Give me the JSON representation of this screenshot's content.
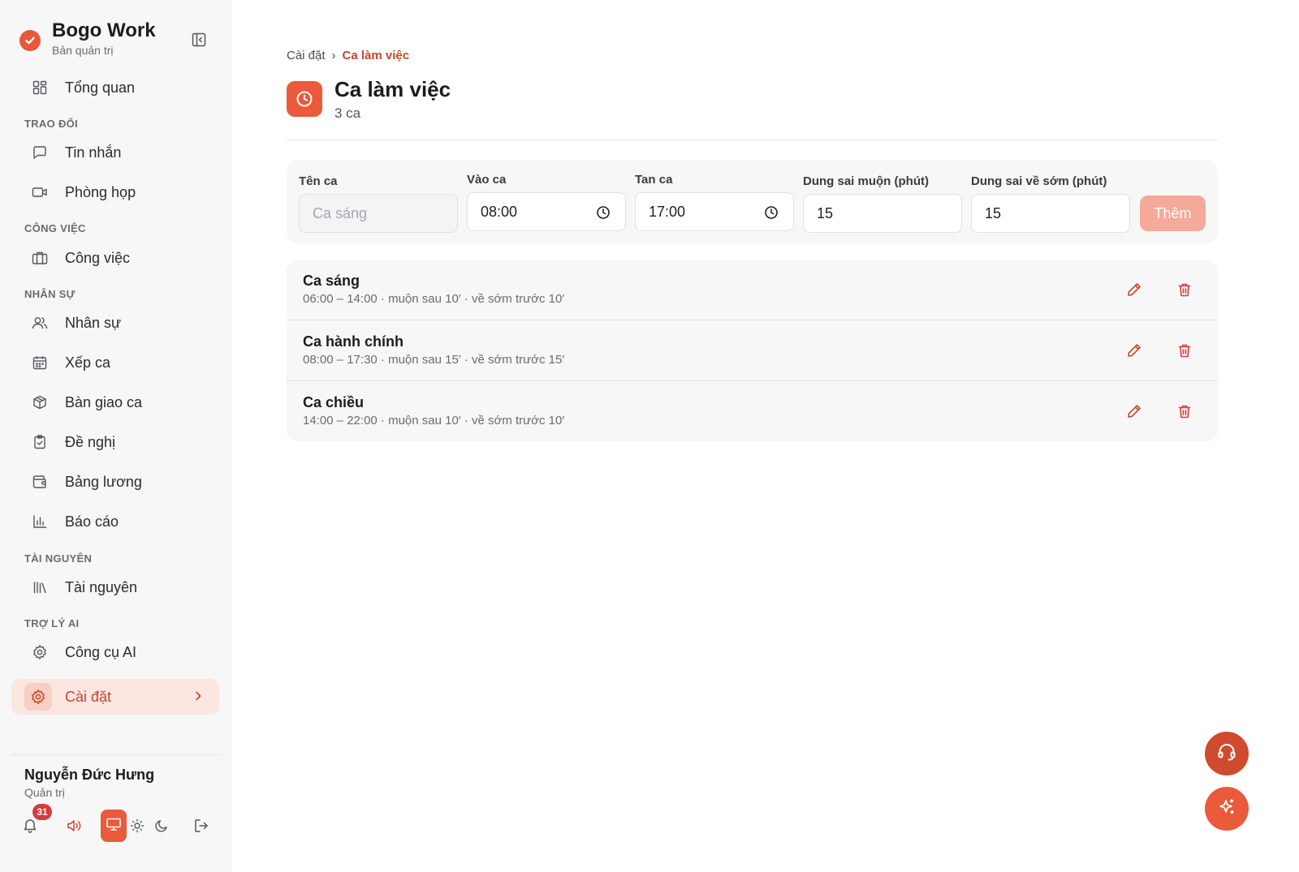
{
  "app": {
    "title": "Bogo Work",
    "subtitle": "Bản quản trị"
  },
  "sidebar": {
    "items": [
      {
        "label": "Tổng quan",
        "icon": "grid-icon"
      },
      {
        "label": "Tin nhắn",
        "icon": "message-icon"
      },
      {
        "label": "Phòng họp",
        "icon": "video-icon"
      },
      {
        "label": "Công việc",
        "icon": "briefcase-icon"
      },
      {
        "label": "Nhân sự",
        "icon": "users-icon"
      },
      {
        "label": "Xếp ca",
        "icon": "calendar-icon"
      },
      {
        "label": "Bàn giao ca",
        "icon": "package-icon"
      },
      {
        "label": "Đề nghị",
        "icon": "clipboard-check-icon"
      },
      {
        "label": "Bảng lương",
        "icon": "wallet-icon"
      },
      {
        "label": "Báo cáo",
        "icon": "bar-chart-icon"
      },
      {
        "label": "Tài nguyên",
        "icon": "library-icon"
      },
      {
        "label": "Công cụ AI",
        "icon": "settings-ai-icon"
      },
      {
        "label": "Cài đặt",
        "icon": "gear-icon",
        "active": true
      }
    ],
    "sections": {
      "trao_doi": "TRAO ĐỔI",
      "cong_viec": "CÔNG VIỆC",
      "nhan_su": "NHÂN SỰ",
      "tai_nguyen": "TÀI NGUYÊN",
      "tro_ly_ai": "TRỢ LÝ AI"
    }
  },
  "user": {
    "name": "Nguyễn Đức Hưng",
    "role": "Quản trị",
    "notification_count": "31"
  },
  "breadcrumb": {
    "parent": "Cài đặt",
    "separator": "›",
    "current": "Ca làm việc"
  },
  "page": {
    "title": "Ca làm việc",
    "subtitle": "3 ca"
  },
  "form": {
    "name_label": "Tên ca",
    "name_placeholder": "Ca sáng",
    "start_label": "Vào ca",
    "start_value": "08:00",
    "end_label": "Tan ca",
    "end_value": "17:00",
    "late_label": "Dung sai muộn (phút)",
    "late_value": "15",
    "early_label": "Dung sai về sớm (phút)",
    "early_value": "15",
    "add_button": "Thêm"
  },
  "shifts": [
    {
      "name": "Ca sáng",
      "meta": "06:00 – 14:00 · muộn sau 10′ · về sớm trước 10′"
    },
    {
      "name": "Ca hành chính",
      "meta": "08:00 – 17:30 · muộn sau 15′ · về sớm trước 15′"
    },
    {
      "name": "Ca chiều",
      "meta": "14:00 – 22:00 · muộn sau 10′ · về sớm trước 10′"
    }
  ],
  "colors": {
    "accent": "#ea5a3b",
    "accent_dark": "#c8452b",
    "accent_light": "#fbe6e0",
    "sidebar_bg": "#f7f7f8"
  }
}
